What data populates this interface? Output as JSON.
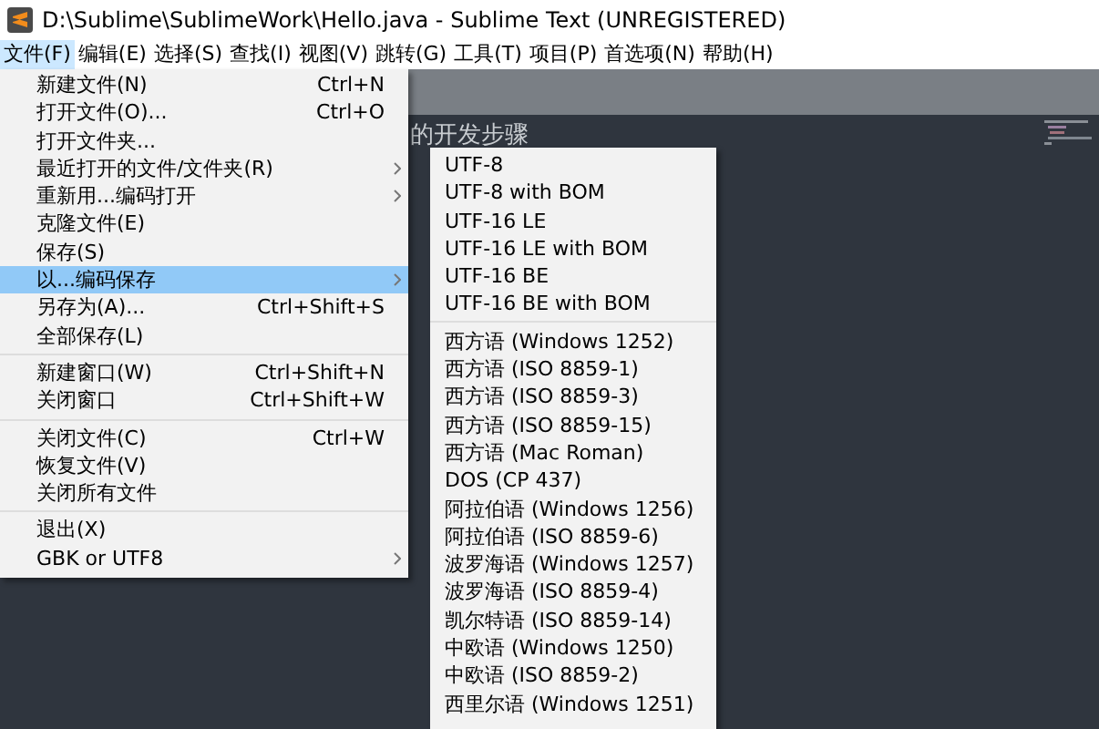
{
  "window": {
    "title": "D:\\Sublime\\SublimeWork\\Hello.java - Sublime Text (UNREGISTERED)"
  },
  "menubar": [
    {
      "label": "文件(F)",
      "selected": true
    },
    {
      "label": "编辑(E)",
      "selected": false
    },
    {
      "label": "选择(S)",
      "selected": false
    },
    {
      "label": "查找(I)",
      "selected": false
    },
    {
      "label": "视图(V)",
      "selected": false
    },
    {
      "label": "跳转(G)",
      "selected": false
    },
    {
      "label": "工具(T)",
      "selected": false
    },
    {
      "label": "项目(P)",
      "selected": false
    },
    {
      "label": "首选项(N)",
      "selected": false
    },
    {
      "label": "帮助(H)",
      "selected": false
    }
  ],
  "editor": {
    "visible_text": "的开发步骤"
  },
  "file_menu": [
    {
      "kind": "item",
      "label": "新建文件(N)",
      "shortcut": "Ctrl+N",
      "submenu": false,
      "selected": false
    },
    {
      "kind": "item",
      "label": "打开文件(O)...",
      "shortcut": "Ctrl+O",
      "submenu": false,
      "selected": false
    },
    {
      "kind": "item",
      "label": "打开文件夹...",
      "submenu": false,
      "selected": false
    },
    {
      "kind": "item",
      "label": "最近打开的文件/文件夹(R)",
      "submenu": true,
      "selected": false
    },
    {
      "kind": "item",
      "label": "重新用...编码打开",
      "submenu": true,
      "selected": false
    },
    {
      "kind": "item",
      "label": "克隆文件(E)",
      "submenu": false,
      "selected": false
    },
    {
      "kind": "item",
      "label": "保存(S)",
      "submenu": false,
      "selected": false
    },
    {
      "kind": "item",
      "label": "以...编码保存",
      "submenu": true,
      "selected": true
    },
    {
      "kind": "item",
      "label": "另存为(A)...",
      "shortcut": "Ctrl+Shift+S",
      "submenu": false,
      "selected": false
    },
    {
      "kind": "item",
      "label": "全部保存(L)",
      "submenu": false,
      "selected": false
    },
    {
      "kind": "separator"
    },
    {
      "kind": "item",
      "label": "新建窗口(W)",
      "shortcut": "Ctrl+Shift+N",
      "submenu": false,
      "selected": false
    },
    {
      "kind": "item",
      "label": "关闭窗口",
      "shortcut": "Ctrl+Shift+W",
      "submenu": false,
      "selected": false
    },
    {
      "kind": "separator"
    },
    {
      "kind": "item",
      "label": "关闭文件(C)",
      "shortcut": "Ctrl+W",
      "submenu": false,
      "selected": false
    },
    {
      "kind": "item",
      "label": "恢复文件(V)",
      "submenu": false,
      "selected": false
    },
    {
      "kind": "item",
      "label": "关闭所有文件",
      "submenu": false,
      "selected": false
    },
    {
      "kind": "separator"
    },
    {
      "kind": "item",
      "label": "退出(X)",
      "submenu": false,
      "selected": false
    },
    {
      "kind": "item",
      "label": "GBK or UTF8",
      "submenu": true,
      "selected": false
    }
  ],
  "encoding_submenu": [
    {
      "kind": "item",
      "label": "UTF-8"
    },
    {
      "kind": "item",
      "label": "UTF-8 with BOM"
    },
    {
      "kind": "item",
      "label": "UTF-16 LE"
    },
    {
      "kind": "item",
      "label": "UTF-16 LE with BOM"
    },
    {
      "kind": "item",
      "label": "UTF-16 BE"
    },
    {
      "kind": "item",
      "label": "UTF-16 BE with BOM"
    },
    {
      "kind": "separator"
    },
    {
      "kind": "item",
      "label": "西方语 (Windows 1252)"
    },
    {
      "kind": "item",
      "label": "西方语 (ISO 8859-1)"
    },
    {
      "kind": "item",
      "label": "西方语 (ISO 8859-3)"
    },
    {
      "kind": "item",
      "label": "西方语 (ISO 8859-15)"
    },
    {
      "kind": "item",
      "label": "西方语 (Mac Roman)"
    },
    {
      "kind": "item",
      "label": "DOS (CP 437)"
    },
    {
      "kind": "item",
      "label": "阿拉伯语 (Windows 1256)"
    },
    {
      "kind": "item",
      "label": "阿拉伯语 (ISO 8859-6)"
    },
    {
      "kind": "item",
      "label": "波罗海语 (Windows 1257)"
    },
    {
      "kind": "item",
      "label": "波罗海语 (ISO 8859-4)"
    },
    {
      "kind": "item",
      "label": "凯尔特语 (ISO 8859-14)"
    },
    {
      "kind": "item",
      "label": "中欧语 (Windows 1250)"
    },
    {
      "kind": "item",
      "label": "中欧语 (ISO 8859-2)"
    },
    {
      "kind": "item",
      "label": "西里尔语 (Windows 1251)"
    }
  ]
}
